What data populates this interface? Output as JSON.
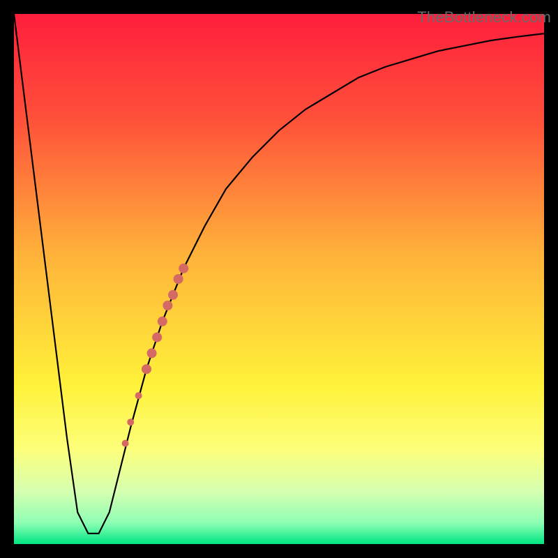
{
  "watermark": "TheBottleneck.com",
  "colors": {
    "frame": "#000000",
    "gradient_stops": [
      {
        "offset": 0.0,
        "color": "#ff1e3c"
      },
      {
        "offset": 0.2,
        "color": "#ff513a"
      },
      {
        "offset": 0.45,
        "color": "#ffb13a"
      },
      {
        "offset": 0.7,
        "color": "#fff23a"
      },
      {
        "offset": 0.82,
        "color": "#fdff7a"
      },
      {
        "offset": 0.9,
        "color": "#d7ffb0"
      },
      {
        "offset": 0.96,
        "color": "#8dffb4"
      },
      {
        "offset": 1.0,
        "color": "#00e582"
      }
    ],
    "curve": "#000000",
    "markers": "#d46a63"
  },
  "chart_data": {
    "type": "line",
    "title": "",
    "xlabel": "",
    "ylabel": "",
    "xlim": [
      0,
      100
    ],
    "ylim": [
      0,
      100
    ],
    "series": [
      {
        "name": "bottleneck-curve",
        "x": [
          0,
          2,
          4,
          6,
          8,
          10,
          12,
          14,
          16,
          18,
          20,
          22,
          25,
          28,
          32,
          36,
          40,
          45,
          50,
          55,
          60,
          65,
          70,
          75,
          80,
          85,
          90,
          95,
          100
        ],
        "y": [
          100,
          84,
          68,
          52,
          36,
          20,
          6,
          2,
          2,
          6,
          14,
          22,
          33,
          42,
          52,
          60,
          67,
          73,
          78,
          82,
          85,
          88,
          90,
          91.5,
          93,
          94,
          95,
          95.7,
          96.3
        ]
      }
    ],
    "markers": {
      "name": "highlight-segment",
      "points": [
        {
          "x": 21.0,
          "y": 19,
          "r": 5
        },
        {
          "x": 22.0,
          "y": 23,
          "r": 5
        },
        {
          "x": 23.5,
          "y": 28,
          "r": 5
        },
        {
          "x": 25.0,
          "y": 33,
          "r": 7
        },
        {
          "x": 26.0,
          "y": 36,
          "r": 7
        },
        {
          "x": 27.0,
          "y": 39,
          "r": 7
        },
        {
          "x": 28.0,
          "y": 42,
          "r": 7
        },
        {
          "x": 29.0,
          "y": 45,
          "r": 7
        },
        {
          "x": 30.0,
          "y": 47,
          "r": 7
        },
        {
          "x": 31.0,
          "y": 50,
          "r": 7
        },
        {
          "x": 32.0,
          "y": 52,
          "r": 7
        }
      ]
    }
  }
}
